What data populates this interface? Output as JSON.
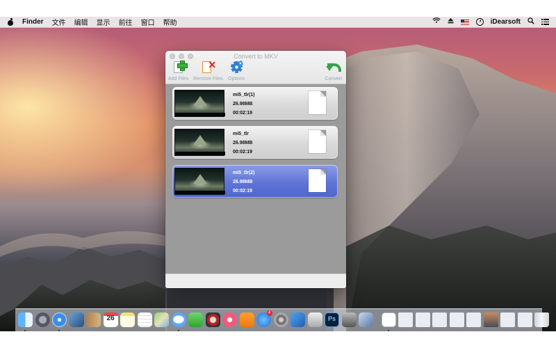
{
  "menubar": {
    "app_name": "Finder",
    "items": [
      "文件",
      "编辑",
      "显示",
      "前往",
      "窗口",
      "帮助"
    ],
    "status_icons": [
      "wifi-icon",
      "eject-icon",
      "flag-icon",
      "clock-icon"
    ],
    "user": "iDearsoft"
  },
  "window": {
    "title": "Convert to MKV",
    "toolbar": {
      "add_label": "Add Files",
      "remove_label": "Remove Files",
      "options_label": "Options",
      "convert_label": "Convert"
    },
    "files": [
      {
        "name": "mi5_tlr(1)",
        "size": "26.98MB",
        "duration": "00:02:19",
        "selected": false
      },
      {
        "name": "mi5_tlr",
        "size": "26.98MB",
        "duration": "00:02:19",
        "selected": false
      },
      {
        "name": "mi5_tlr(2)",
        "size": "26.98MB",
        "duration": "00:02:19",
        "selected": true
      }
    ]
  },
  "dock": {
    "calendar_day": "26",
    "photoshop_label": "Ps",
    "appstore_badge": "4",
    "accent_colors": {
      "selection": "#5f74d6",
      "add_green": "#3cb23c",
      "remove_red": "#e02020"
    }
  }
}
